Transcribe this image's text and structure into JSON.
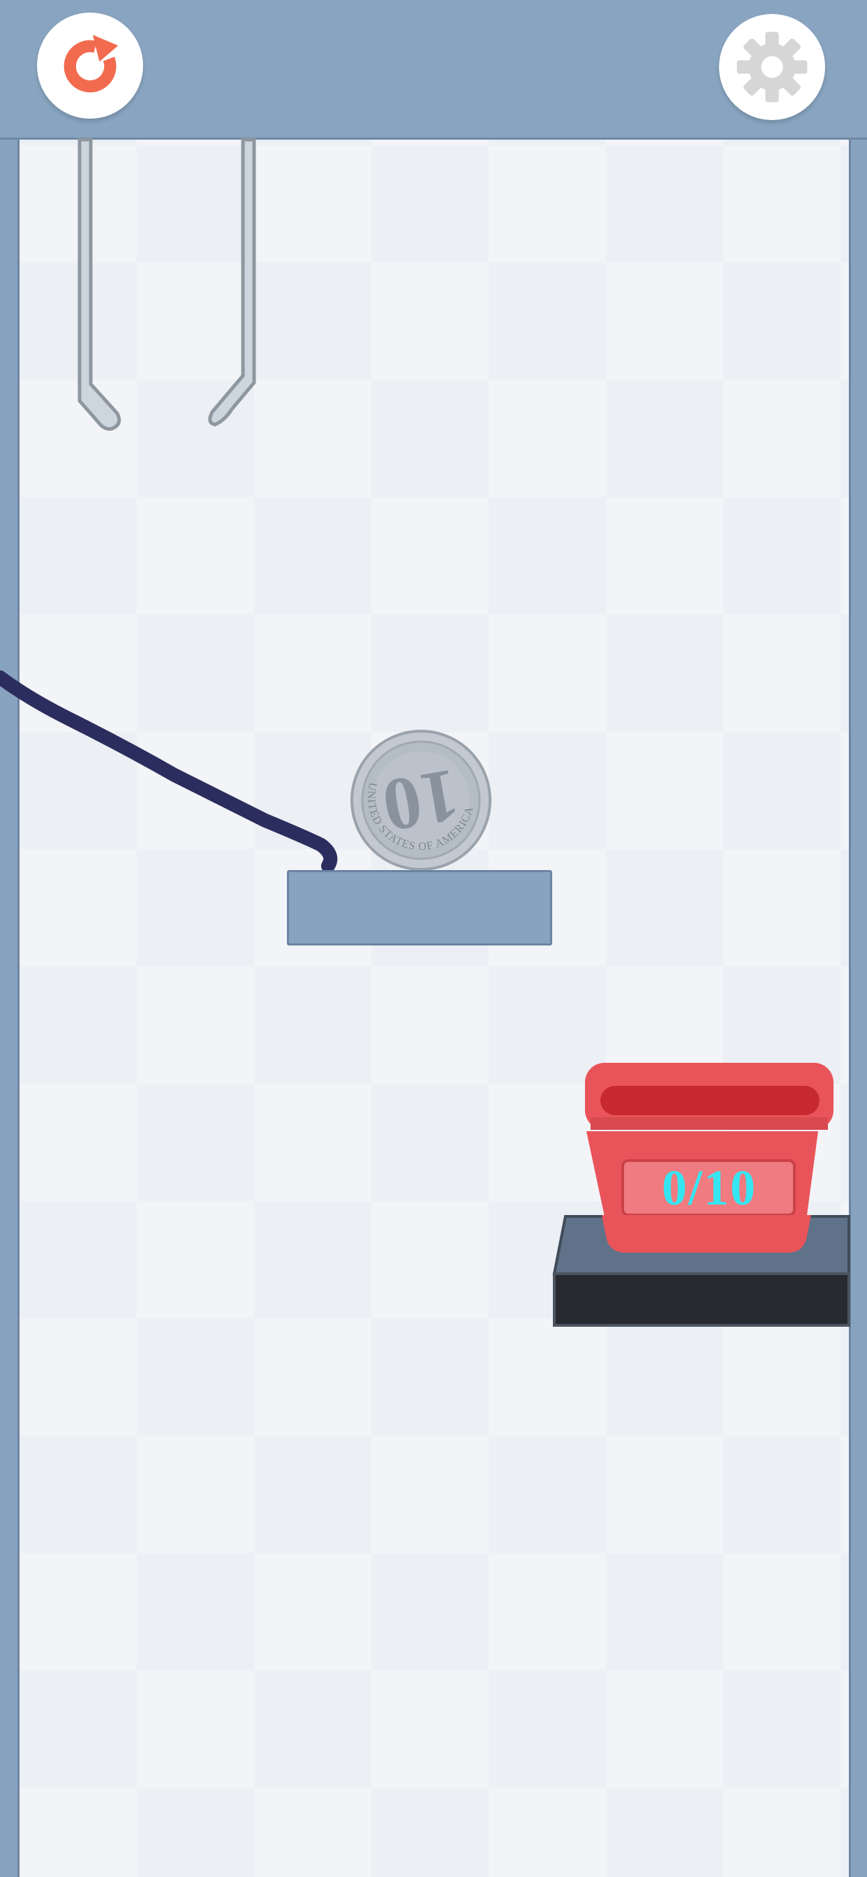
{
  "toolbar": {
    "restart_icon": "restart-icon",
    "settings_icon": "gear-icon"
  },
  "coin": {
    "denomination": "10",
    "inscription": "UNITED STATES OF AMERICA"
  },
  "basket": {
    "count": 0,
    "goal": 10,
    "label": "0/10"
  },
  "colors": {
    "frame": "#88a4c0",
    "restart_accent": "#f26b4f",
    "gear": "#d6d6d6",
    "ink_line": "#2b2d5e",
    "basket": "#e9545a",
    "counter_text": "#35e6f2",
    "shelf_top": "#5f7289",
    "shelf_front": "#272b30"
  }
}
